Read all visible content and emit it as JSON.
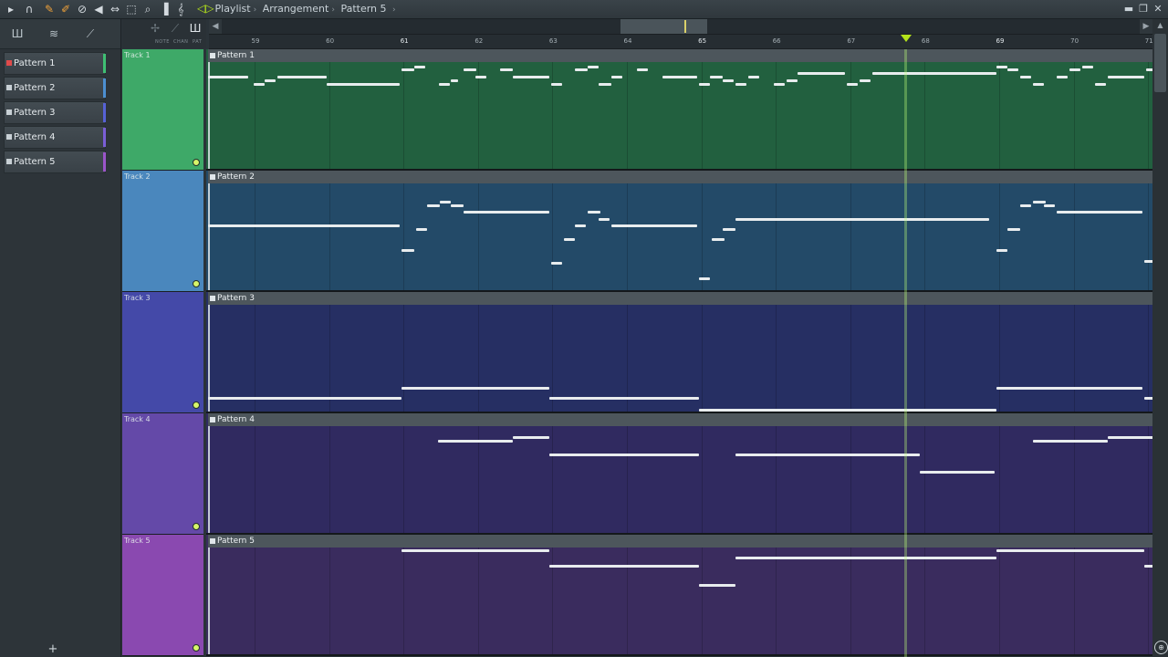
{
  "window": {
    "title_parts": [
      "Playlist",
      "Arrangement",
      "Pattern 5"
    ],
    "separator": "›",
    "minimize_glyph": "▬",
    "restore_glyph": "❐",
    "close_glyph": "✕"
  },
  "toolbar_icons": [
    {
      "name": "menu-arrow-icon",
      "glyph": "▸"
    },
    {
      "name": "magnet-icon",
      "glyph": "∩"
    },
    {
      "name": "pencil-icon",
      "glyph": "✎"
    },
    {
      "name": "paint-brush-icon",
      "glyph": "✐"
    },
    {
      "name": "delete-icon",
      "glyph": "⊘"
    },
    {
      "name": "mute-icon",
      "glyph": "◀"
    },
    {
      "name": "slip-icon",
      "glyph": "⇔"
    },
    {
      "name": "select-icon",
      "glyph": "⬚"
    },
    {
      "name": "zoom-icon",
      "glyph": "⌕"
    },
    {
      "name": "playback-icon",
      "glyph": "▐"
    },
    {
      "name": "piano-icon",
      "glyph": "𝄞"
    }
  ],
  "picker_tools": [
    {
      "name": "piano-roll-tool-icon",
      "glyph": "Ш"
    },
    {
      "name": "audio-clip-tool-icon",
      "glyph": "≋"
    },
    {
      "name": "automation-tool-icon",
      "glyph": "⟋"
    }
  ],
  "mini_tools": {
    "labels": [
      "NOTE",
      "CHAN",
      "PAT"
    ]
  },
  "patterns": [
    {
      "label": "Pattern 1",
      "color": "#3fbf73"
    },
    {
      "label": "Pattern 2",
      "color": "#4c8fd1"
    },
    {
      "label": "Pattern 3",
      "color": "#5662d6"
    },
    {
      "label": "Pattern 4",
      "color": "#7a5ed6"
    },
    {
      "label": "Pattern 5",
      "color": "#9b55c9"
    }
  ],
  "add_pattern_glyph": "+",
  "ruler": {
    "ticks": [
      "59",
      "60",
      "61",
      "62",
      "63",
      "64",
      "65",
      "66",
      "67",
      "68",
      "69",
      "70",
      "71"
    ],
    "major_ticks": [
      "61",
      "65",
      "69"
    ]
  },
  "tracks": [
    {
      "name": "Track 1",
      "clip_label": "Pattern 1",
      "header_color": "#3ea968",
      "lane_color": "#22603f"
    },
    {
      "name": "Track 2",
      "clip_label": "Pattern 2",
      "header_color": "#4a87bd",
      "lane_color": "#234a68"
    },
    {
      "name": "Track 3",
      "clip_label": "Pattern 3",
      "header_color": "#4449a8",
      "lane_color": "#262f63"
    },
    {
      "name": "Track 4",
      "clip_label": "Pattern 4",
      "header_color": "#6449a8",
      "lane_color": "#302a60"
    },
    {
      "name": "Track 5",
      "clip_label": "Pattern 5",
      "header_color": "#8a49b0",
      "lane_color": "#3a2c5e"
    }
  ],
  "scroll_arrows": {
    "left": "◀",
    "right": "▶",
    "up": "▲"
  },
  "zoom_glyph": "⊕"
}
